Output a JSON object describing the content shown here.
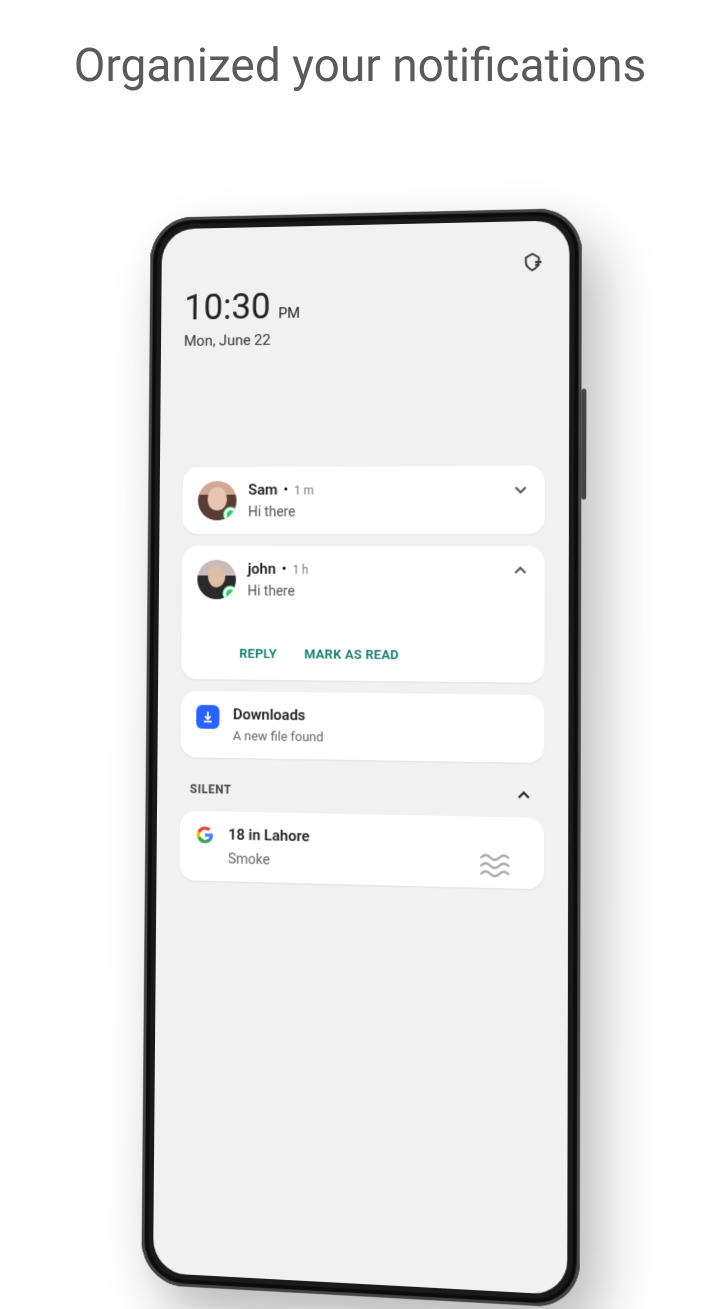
{
  "headline": "Organized your notifications",
  "clock": {
    "time": "10:30",
    "period": "PM",
    "date": "Mon, June 22"
  },
  "chats": [
    {
      "sender": "Sam",
      "time": "1 m",
      "text": "Hi there",
      "expanded": false
    },
    {
      "sender": "john",
      "time": "1 h",
      "text": "Hi there",
      "expanded": true,
      "actions": {
        "reply": "REPLY",
        "mark": "MARK AS READ"
      }
    }
  ],
  "download": {
    "title": "Downloads",
    "subtitle": "A new file found"
  },
  "silent": {
    "label": "SILENT",
    "weather": {
      "title": "18 in Lahore",
      "condition": "Smoke"
    }
  },
  "icons": {
    "settings": "settings-icon",
    "chevron_down": "chevron-down-icon",
    "chevron_up": "chevron-up-icon",
    "whatsapp_badge": "whatsapp-badge-icon",
    "download": "download-icon",
    "google": "google-g-icon",
    "fog": "fog-icon"
  },
  "colors": {
    "accent": "#0b7a64",
    "download_bg": "#2962ff",
    "whatsapp": "#25d366"
  }
}
